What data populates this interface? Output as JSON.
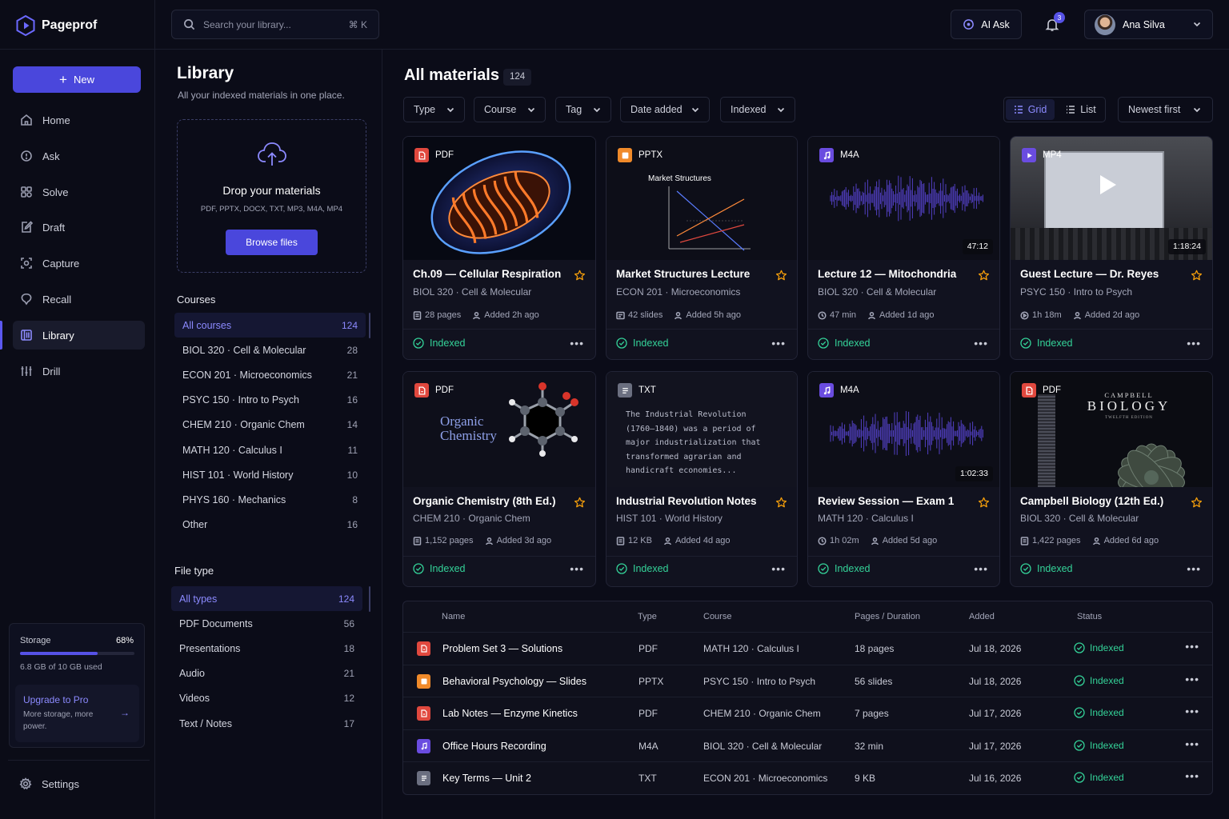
{
  "app": {
    "name": "Pageprof"
  },
  "nav": {
    "new_label": "New",
    "items": [
      {
        "label": "Home",
        "icon": "home-icon"
      },
      {
        "label": "Ask",
        "icon": "ask-icon"
      },
      {
        "label": "Solve",
        "icon": "solve-icon"
      },
      {
        "label": "Draft",
        "icon": "draft-icon"
      },
      {
        "label": "Capture",
        "icon": "capture-icon"
      },
      {
        "label": "Recall",
        "icon": "recall-icon"
      },
      {
        "label": "Library",
        "icon": "library-icon"
      },
      {
        "label": "Drill",
        "icon": "drill-icon"
      }
    ],
    "active": "Library",
    "storage": {
      "label": "Storage",
      "percent_text": "68%",
      "fraction": 0.68,
      "used_text": "6.8 GB of 10 GB used"
    },
    "upgrade": {
      "title": "Upgrade to Pro",
      "subtitle": "More storage, more power.",
      "arrow": "→"
    },
    "settings_label": "Settings"
  },
  "topbar": {
    "search_placeholder": "Search your library...",
    "search_shortcut": "⌘ K",
    "ai_ask_label": "AI Ask",
    "notifications_count": "3",
    "user_name": "Ana Silva"
  },
  "library": {
    "title": "Library",
    "subtitle": "All your indexed materials in one place.",
    "dropzone": {
      "title": "Drop your materials",
      "formats": "PDF, PPTX, DOCX, TXT, MP3, M4A, MP4",
      "button": "Browse files"
    },
    "courses_heading": "Courses",
    "courses": [
      {
        "label": "All courses",
        "count": "124"
      },
      {
        "label": "BIOL 320 · Cell & Molecular",
        "count": "28"
      },
      {
        "label": "ECON 201 · Microeconomics",
        "count": "21"
      },
      {
        "label": "PSYC 150 · Intro to Psych",
        "count": "16"
      },
      {
        "label": "CHEM 210 · Organic Chem",
        "count": "14"
      },
      {
        "label": "MATH 120 · Calculus I",
        "count": "11"
      },
      {
        "label": "HIST 101 · World History",
        "count": "10"
      },
      {
        "label": "PHYS 160 · Mechanics",
        "count": "8"
      },
      {
        "label": "Other",
        "count": "16"
      }
    ],
    "filetype_heading": "File type",
    "filetypes": [
      {
        "label": "All types",
        "count": "124"
      },
      {
        "label": "PDF Documents",
        "count": "56"
      },
      {
        "label": "Presentations",
        "count": "18"
      },
      {
        "label": "Audio",
        "count": "21"
      },
      {
        "label": "Videos",
        "count": "12"
      },
      {
        "label": "Text / Notes",
        "count": "17"
      }
    ]
  },
  "main": {
    "title": "All materials",
    "count": "124",
    "filters": [
      "Type",
      "Course",
      "Tag",
      "Date added",
      "Indexed"
    ],
    "view_grid": "Grid",
    "view_list": "List",
    "sort": "Newest first",
    "cards": [
      {
        "type": "PDF",
        "title": "Ch.09 — Cellular Respiration",
        "course": "BIOL 320 · Cell & Molecular",
        "size": "28 pages",
        "added": "Added 2h ago",
        "status": "Indexed",
        "thumb": "mitochondria-illustration"
      },
      {
        "type": "PPTX",
        "title": "Market Structures Lecture",
        "course": "ECON 201 · Microeconomics",
        "size": "42 slides",
        "added": "Added 5h ago",
        "status": "Indexed",
        "thumb": "slide-chart",
        "slide_title": "Market Structures"
      },
      {
        "type": "M4A",
        "title": "Lecture 12 — Mitochondria",
        "course": "BIOL 320 · Cell & Molecular",
        "size": "47 min",
        "added": "Added 1d ago",
        "status": "Indexed",
        "thumb": "waveform",
        "duration": "47:12"
      },
      {
        "type": "MP4",
        "title": "Guest Lecture — Dr. Reyes",
        "course": "PSYC 150 · Intro to Psych",
        "size": "1h 18m",
        "added": "Added 2d ago",
        "status": "Indexed",
        "thumb": "lecture-video",
        "duration": "1:18:24"
      },
      {
        "type": "PDF",
        "title": "Organic Chemistry (8th Ed.)",
        "course": "CHEM 210 · Organic Chem",
        "size": "1,152 pages",
        "added": "Added 3d ago",
        "status": "Indexed",
        "thumb": "molecule-cover",
        "cover_line1": "Organic",
        "cover_line2": "Chemistry"
      },
      {
        "type": "TXT",
        "title": "Industrial Revolution Notes",
        "course": "HIST 101 · World History",
        "size": "12 KB",
        "added": "Added 4d ago",
        "status": "Indexed",
        "thumb": "text-preview",
        "preview": "The Industrial Revolution (1760–1840) was a period of major industrialization that transformed agrarian and handicraft economies..."
      },
      {
        "type": "M4A",
        "title": "Review Session — Exam 1",
        "course": "MATH 120 · Calculus I",
        "size": "1h 02m",
        "added": "Added 5d ago",
        "status": "Indexed",
        "thumb": "waveform",
        "duration": "1:02:33"
      },
      {
        "type": "PDF",
        "title": "Campbell Biology (12th Ed.)",
        "course": "BIOL 320 · Cell & Molecular",
        "size": "1,422 pages",
        "added": "Added 6d ago",
        "status": "Indexed",
        "thumb": "succulent-cover",
        "cover_line1": "CAMPBELL",
        "cover_line2": "BIOLOGY",
        "cover_line3": "TWELFTH EDITION"
      }
    ],
    "table": {
      "headers": [
        "Name",
        "Type",
        "Course",
        "Pages / Duration",
        "Added",
        "Status"
      ],
      "rows": [
        {
          "name": "Problem Set 3 — Solutions",
          "type": "PDF",
          "course": "MATH 120 · Calculus I",
          "size": "18 pages",
          "added": "Jul 18, 2026",
          "status": "Indexed"
        },
        {
          "name": "Behavioral Psychology — Slides",
          "type": "PPTX",
          "course": "PSYC 150 · Intro to Psych",
          "size": "56 slides",
          "added": "Jul 18, 2026",
          "status": "Indexed"
        },
        {
          "name": "Lab Notes — Enzyme Kinetics",
          "type": "PDF",
          "course": "CHEM 210 · Organic Chem",
          "size": "7 pages",
          "added": "Jul 17, 2026",
          "status": "Indexed"
        },
        {
          "name": "Office Hours Recording",
          "type": "M4A",
          "course": "BIOL 320 · Cell & Molecular",
          "size": "32 min",
          "added": "Jul 17, 2026",
          "status": "Indexed"
        },
        {
          "name": "Key Terms — Unit 2",
          "type": "TXT",
          "course": "ECON 201 · Microeconomics",
          "size": "9 KB",
          "added": "Jul 16, 2026",
          "status": "Indexed"
        }
      ]
    }
  },
  "colors": {
    "accent": "#4a47dc",
    "success": "#34d399",
    "pdf": "#e0483e",
    "pptx": "#f08a2a",
    "audio": "#6a4ce0",
    "txt": "#6b6f80"
  }
}
